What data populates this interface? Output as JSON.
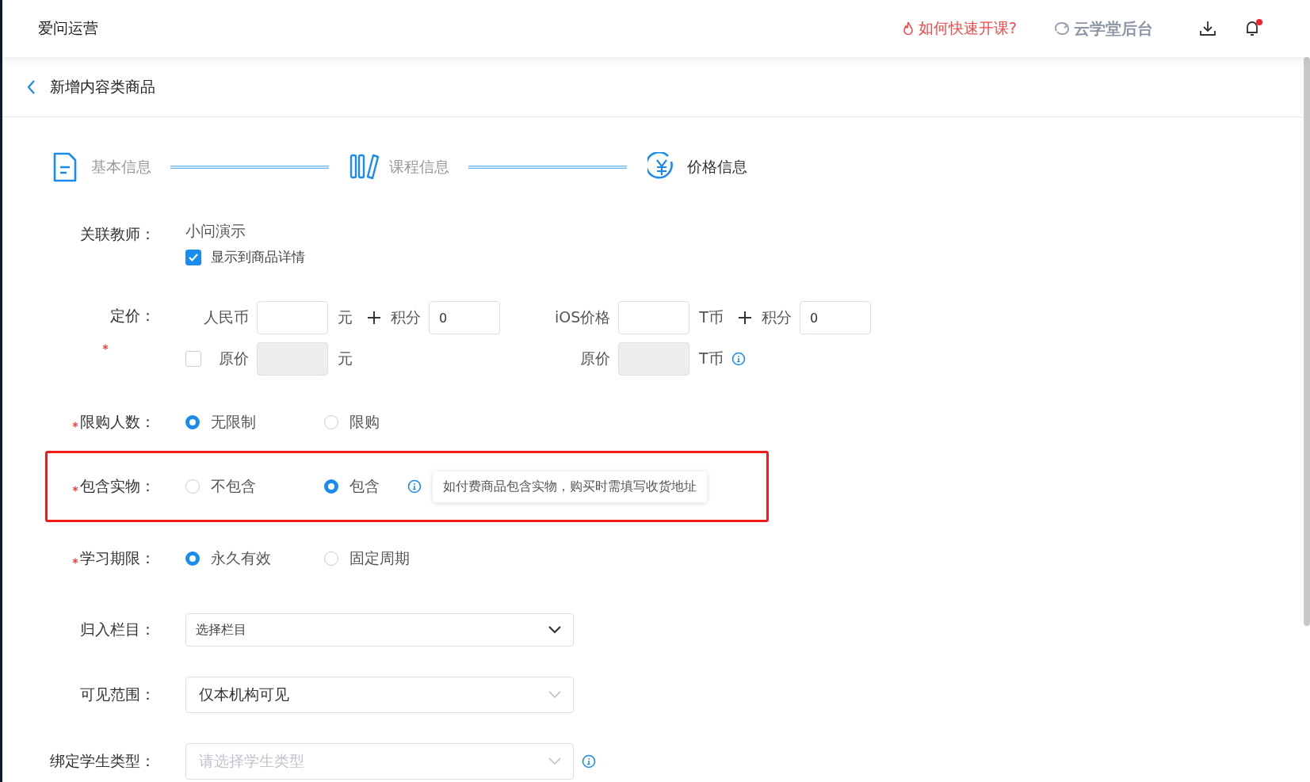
{
  "header": {
    "app_name": "爱问运营",
    "help_link": "如何快速开课?",
    "backend_link": "云学堂后台",
    "has_notification": true
  },
  "page_title": "新增内容类商品",
  "steps": [
    {
      "label": "基本信息",
      "kind": "doc",
      "selected": false
    },
    {
      "label": "课程信息",
      "kind": "books",
      "selected": false
    },
    {
      "label": "价格信息",
      "kind": "yuan",
      "selected": true
    }
  ],
  "teacher": {
    "label": "关联教师：",
    "value": "小问演示",
    "checkbox": {
      "label": "显示到商品详情",
      "checked": true
    }
  },
  "price": {
    "label": "定价：",
    "required": true,
    "main": [
      {
        "label": "人民币",
        "unit": "元",
        "points_label": "积分",
        "points_value": "0"
      },
      {
        "label": "iOS价格",
        "unit": "T币",
        "points_label": "积分",
        "points_value": "0"
      }
    ],
    "original": [
      {
        "label": "原价",
        "unit": "元",
        "kind": "checkbox",
        "checked": false
      },
      {
        "label": "原价",
        "unit": "T币",
        "kind": "info"
      }
    ]
  },
  "radio_rows": [
    {
      "label": "限购人数：",
      "required": true,
      "highlighted": false,
      "options": [
        {
          "label": "无限制",
          "selected": true
        },
        {
          "label": "限购",
          "selected": false
        }
      ]
    },
    {
      "label": "包含实物：",
      "required": true,
      "highlighted": true,
      "options": [
        {
          "label": "不包含",
          "selected": false
        },
        {
          "label": "包含",
          "selected": true
        }
      ],
      "tooltip": "如付费商品包含实物，购买时需填写收货地址"
    },
    {
      "label": "学习期限：",
      "required": true,
      "highlighted": false,
      "options": [
        {
          "label": "永久有效",
          "selected": true
        },
        {
          "label": "固定周期",
          "selected": false
        }
      ]
    }
  ],
  "select_rows": [
    {
      "label": "归入栏目：",
      "value": "选择栏目",
      "kind": "compact",
      "info": false
    },
    {
      "label": "可见范围：",
      "value": "仅本机构可见",
      "kind": "large",
      "info": false
    },
    {
      "label": "绑定学生类型：",
      "placeholder": "请选择学生类型",
      "kind": "large",
      "info": true
    }
  ]
}
